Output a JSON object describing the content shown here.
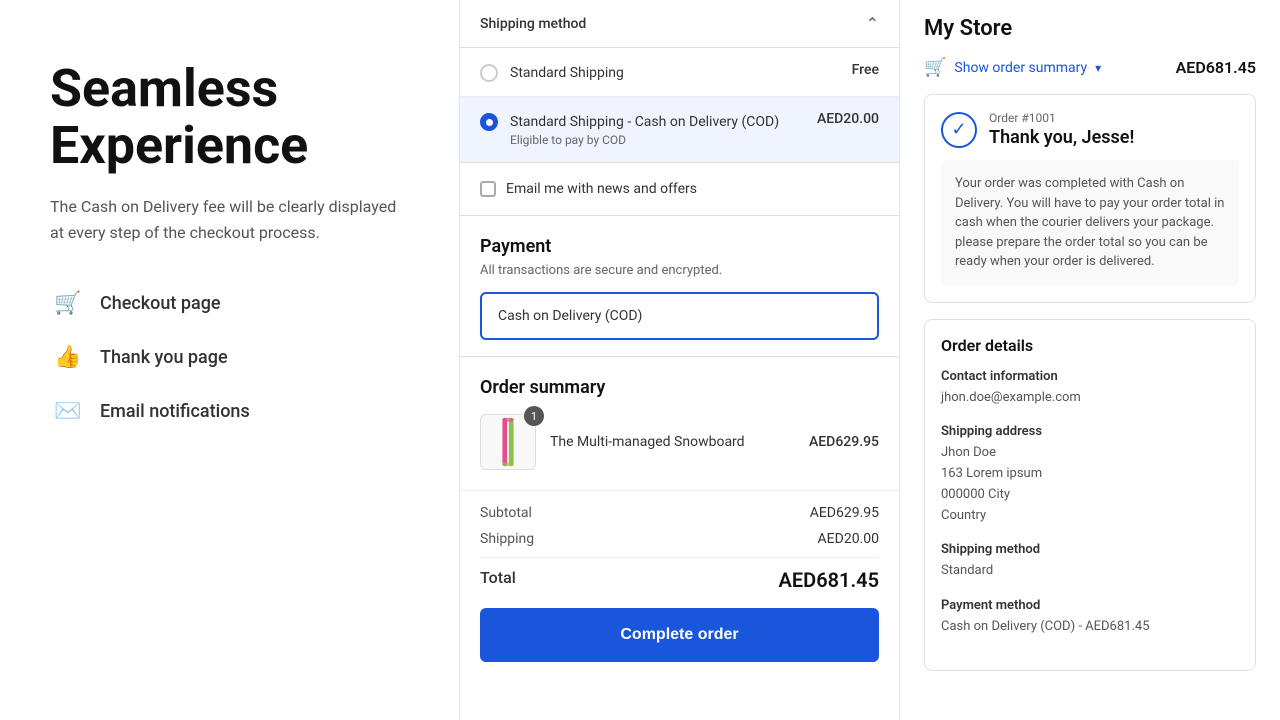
{
  "left": {
    "headline": "Seamless Experience",
    "description": "The Cash on Delivery fee will be clearly displayed at every step of the checkout process.",
    "features": [
      {
        "id": "checkout-page",
        "icon": "🛒",
        "label": "Checkout page"
      },
      {
        "id": "thank-you-page",
        "icon": "👍",
        "label": "Thank you page"
      },
      {
        "id": "email-notifications",
        "icon": "✉️",
        "label": "Email notifications"
      }
    ]
  },
  "middle": {
    "shipping": {
      "section_title": "Shipping method",
      "options": [
        {
          "id": "standard",
          "name": "Standard Shipping",
          "price": "Free",
          "selected": false,
          "sub": ""
        },
        {
          "id": "cod",
          "name": "Standard Shipping - Cash on Delivery (COD)",
          "price": "AED20.00",
          "selected": true,
          "sub": "Eligible to pay by COD"
        }
      ]
    },
    "email_checkbox": {
      "label": "Email me with news and offers",
      "checked": false
    },
    "payment": {
      "title": "Payment",
      "subtitle": "All transactions are secure and encrypted.",
      "method": "Cash on Delivery (COD)"
    },
    "order_summary": {
      "title": "Order summary",
      "product": {
        "name": "The Multi-managed Snowboard",
        "price": "AED629.95",
        "quantity": 1
      },
      "subtotal_label": "Subtotal",
      "subtotal_value": "AED629.95",
      "shipping_label": "Shipping",
      "shipping_value": "AED20.00",
      "total_label": "Total",
      "total_value": "AED681.45"
    },
    "complete_order_btn": "Complete order"
  },
  "right": {
    "store_name": "My Store",
    "show_summary_label": "Show order summary",
    "show_summary_chevron": "▾",
    "order_total": "AED681.45",
    "cart_icon": "🛒",
    "order_confirmed": {
      "order_number": "Order #1001",
      "thank_you": "Thank you, Jesse!",
      "check_symbol": "✓",
      "description": "Your order was completed with Cash on Delivery. You will have to pay your order total in cash when the courier delivers your package. please prepare the order total so you can be ready when your order is delivered."
    },
    "order_details": {
      "title": "Order details",
      "contact_info_label": "Contact information",
      "contact_info_value": "jhon.doe@example.com",
      "shipping_address_label": "Shipping address",
      "shipping_address": {
        "name": "Jhon Doe",
        "street": "163 Lorem ipsum",
        "city_zip": "000000 City",
        "country": "Country"
      },
      "shipping_method_label": "Shipping method",
      "shipping_method_value": "Standard",
      "payment_method_label": "Payment method",
      "payment_method_value": "Cash on Delivery (COD) - AED681.45"
    }
  }
}
